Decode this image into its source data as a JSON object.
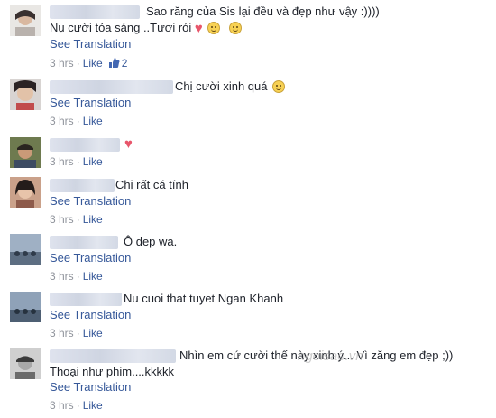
{
  "comments": [
    {
      "text_line1": "Sao răng của Sis lại đều và đẹp như vậy :))))",
      "text_line2": "Nụ cười tỏa sáng ..Tươi rói",
      "see_translation": "See Translation",
      "time": "3 hrs",
      "like": "Like",
      "like_count": "2"
    },
    {
      "text": "Chị cười xinh quá",
      "see_translation": "See Translation",
      "time": "3 hrs",
      "like": "Like"
    },
    {
      "time": "3 hrs",
      "like": "Like"
    },
    {
      "text": "Chị rất cá tính",
      "see_translation": "See Translation",
      "time": "3 hrs",
      "like": "Like"
    },
    {
      "text": "Ô dep wa.",
      "see_translation": "See Translation",
      "time": "3 hrs",
      "like": "Like"
    },
    {
      "text": "Nu cuoi that tuyet Ngan Khanh",
      "see_translation": "See Translation",
      "time": "3 hrs",
      "like": "Like"
    },
    {
      "text_line1": "Nhìn em cứ cười thế này xinh ý... Vì zăng em đẹp ;))",
      "text_line2": "Thoại như phim....kkkkk",
      "see_translation": "See Translation",
      "time": "3 hrs",
      "like": "Like"
    }
  ],
  "watermark": "ngoisao.vn",
  "colors": {
    "link": "#365899",
    "meta": "#90949c",
    "heart": "#e8566b",
    "emoji": "#f7d154"
  },
  "icons": [
    "avatar",
    "smiley-emoji",
    "heart-emoji",
    "thumbs-up-icon"
  ]
}
